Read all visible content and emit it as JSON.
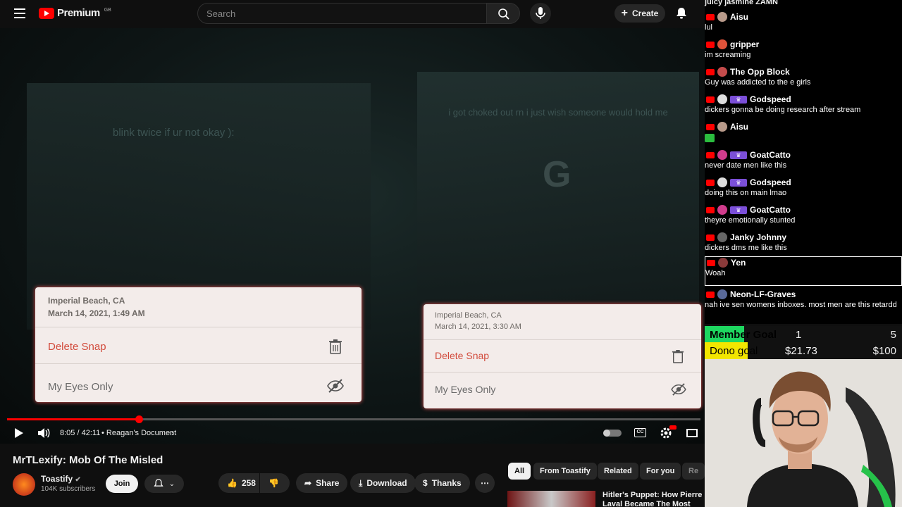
{
  "header": {
    "logo_text": "Premium",
    "logo_region": "GB",
    "search_placeholder": "Search",
    "create_label": "Create"
  },
  "video": {
    "overlay_text_left": "blink twice if ur not okay ):",
    "overlay_text_right": "i got choked out rn i just wish someone would hold me",
    "overlay_letter": "G",
    "snap_left": {
      "location": "Imperial Beach, CA",
      "date": "March 14, 2021, 1:49 AM",
      "delete_label": "Delete Snap",
      "eyes_label": "My Eyes Only"
    },
    "snap_right": {
      "location": "Imperial Beach, CA",
      "date": "March 14, 2021, 3:30 AM",
      "delete_label": "Delete Snap",
      "eyes_label": "My Eyes Only"
    }
  },
  "player": {
    "progress_fraction": 0.19,
    "time": "8:05 / 42:11",
    "chapter": "• Reagan's Document"
  },
  "info": {
    "title": "MrTLexify: Mob Of The Misled",
    "channel": "Toastify",
    "subscribers": "104K subscribers",
    "join_label": "Join",
    "likes": "258",
    "share_label": "Share",
    "download_label": "Download",
    "thanks_label": "Thanks"
  },
  "chips": [
    "All",
    "From Toastify",
    "Related",
    "For you",
    "Re"
  ],
  "related": {
    "title": "Hitler's Puppet: How Pierre Laval Became The Most Hated"
  },
  "chat": {
    "top_cut": "juicy jasmine ZAMN",
    "messages": [
      {
        "user": "Aisu",
        "text": "lul",
        "avatar": "#b89a8a",
        "mod": false
      },
      {
        "user": "gripper",
        "text": "im screaming",
        "avatar": "#e0533a",
        "mod": false
      },
      {
        "user": "The Opp Block",
        "text": "Guy was addicted to the e girls",
        "avatar": "#c44b4b",
        "mod": false
      },
      {
        "user": "Godspeed",
        "text": "dickers gonna be doing research after stream",
        "avatar": "#dddddd",
        "mod": true
      },
      {
        "user": "Aisu",
        "text": "",
        "avatar": "#b89a8a",
        "mod": false
      },
      {
        "user": "GoatCatto",
        "text": "never date men like this",
        "avatar": "#d13c8c",
        "mod": true
      },
      {
        "user": "Godspeed",
        "text": "doing this on main lmao",
        "avatar": "#dddddd",
        "mod": true
      },
      {
        "user": "GoatCatto",
        "text": "theyre emotionally stunted",
        "avatar": "#d13c8c",
        "mod": true
      },
      {
        "user": "Janky Johnny",
        "text": "dickers dms me like this",
        "avatar": "#666666",
        "mod": false
      },
      {
        "user": "Yen",
        "text": "Woah",
        "avatar": "#8a3a3a",
        "mod": false
      },
      {
        "user": "Neon-LF-Graves",
        "text": "nah ive sen womens inboxes. most men are this retardd",
        "avatar": "#5a6a9a",
        "mod": false
      }
    ]
  },
  "goals": {
    "member_label": "Member Goal",
    "member_current": "1",
    "member_target": "5",
    "member_fraction": 0.2,
    "dono_label": "Dono goal",
    "dono_current": "$21.73",
    "dono_target": "$100",
    "dono_fraction": 0.2173
  },
  "colors": {
    "accent": "#ff0000",
    "member_fill": "#1ed760",
    "dono_fill": "#f2e600"
  }
}
